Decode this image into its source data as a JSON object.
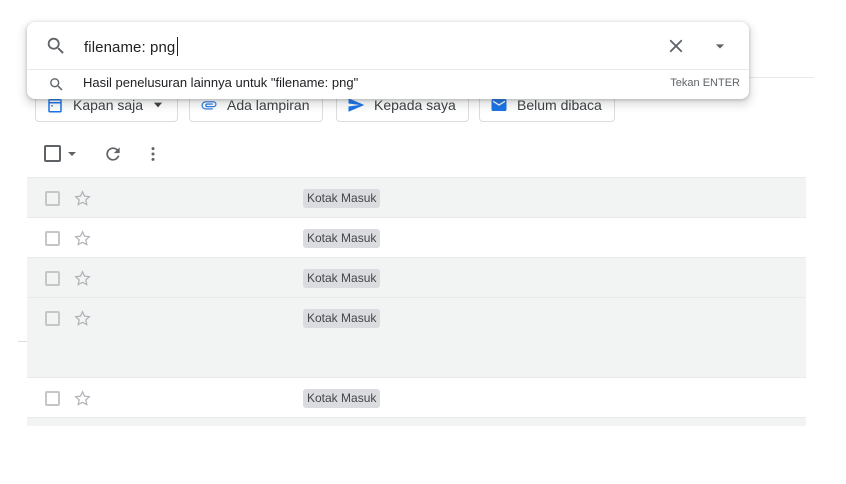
{
  "search": {
    "query": "filename: png",
    "suggestion": "Hasil penelusuran lainnya untuk \"filename: png\"",
    "suggestion_hint": "Tekan ENTER",
    "icons": {
      "search": "search-icon",
      "clear": "close-icon",
      "options": "dropdown-arrow-icon"
    }
  },
  "filters": [
    {
      "label": "Kapan saja",
      "icon": "calendar-icon",
      "has_dropdown": true
    },
    {
      "label": "Ada lampiran",
      "icon": "attachment-icon",
      "has_dropdown": false
    },
    {
      "label": "Kepada saya",
      "icon": "send-icon",
      "has_dropdown": false
    },
    {
      "label": "Belum dibaca",
      "icon": "mail-icon",
      "has_dropdown": false
    }
  ],
  "toolbar": {
    "icons": [
      "select-all-checkbox",
      "select-dropdown-icon",
      "refresh-icon",
      "more-vert-icon"
    ]
  },
  "rows": [
    {
      "label": "Kotak Masuk",
      "shaded": true
    },
    {
      "label": "Kotak Masuk",
      "shaded": false
    },
    {
      "label": "Kotak Masuk",
      "shaded": true
    },
    {
      "label": "Kotak Masuk",
      "shaded": true
    },
    {
      "label": "Kotak Masuk",
      "shaded": false
    }
  ],
  "colors": {
    "icon_gray": "#5f6368",
    "accent_blue": "#1a73e8",
    "row_shade": "#f2f3f3",
    "badge_bg": "#dadce0"
  }
}
